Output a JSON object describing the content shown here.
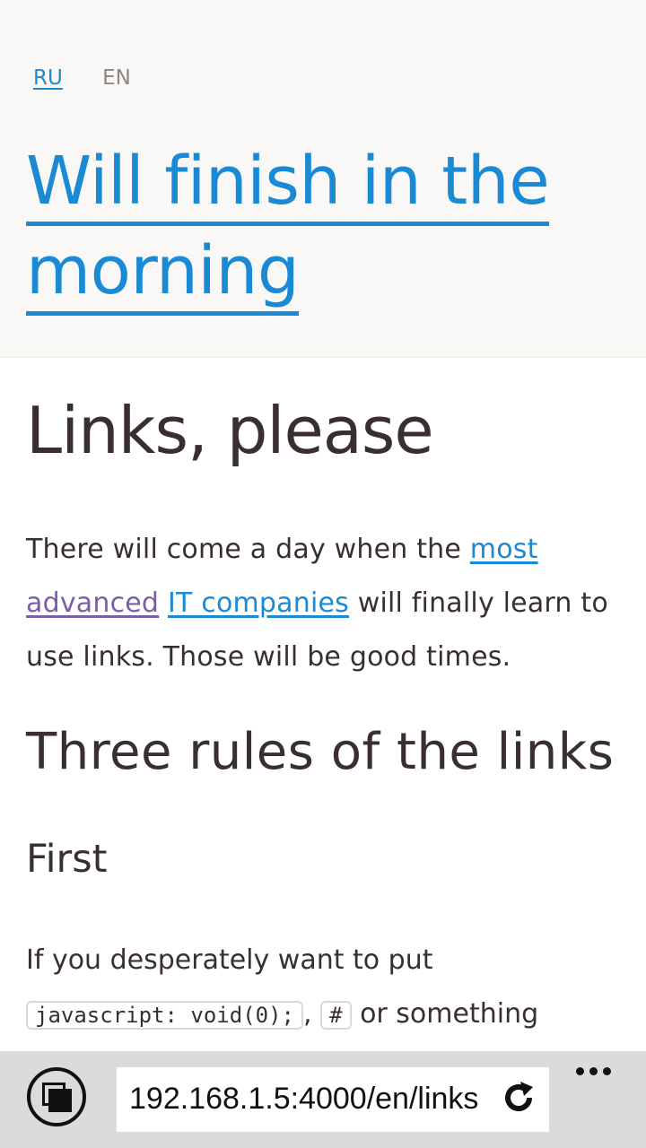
{
  "header": {
    "languages": [
      {
        "label": "RU",
        "active": true
      },
      {
        "label": "EN",
        "active": false
      }
    ],
    "site_title_line1": "Will finish in the",
    "site_title_line2": "morning"
  },
  "article": {
    "title": "Links, please",
    "intro_before": "There will come a day when the ",
    "link_most": "most",
    "link_advanced": "advanced",
    "intro_space": " ",
    "link_it_companies": "IT companies",
    "intro_after": " will finally learn to use links. Those will be good times.",
    "section_title": "Three rules of the links",
    "rule_title": "First",
    "rule_text_line1": "If you desperately want to put",
    "code1": "javascript: void(0);",
    "code_sep": ",",
    "code2": "#",
    "rule_text_tail": " or something"
  },
  "browser": {
    "url": "192.168.1.5:4000/en/links",
    "tabs_icon": "tabs-icon",
    "refresh_icon": "refresh-icon",
    "more_icon": "more-icon"
  },
  "colors": {
    "accent": "#1a8ad4",
    "visited": "#7a5ea8",
    "text": "#3a2f2f",
    "header_bg": "#f9f8f6"
  }
}
